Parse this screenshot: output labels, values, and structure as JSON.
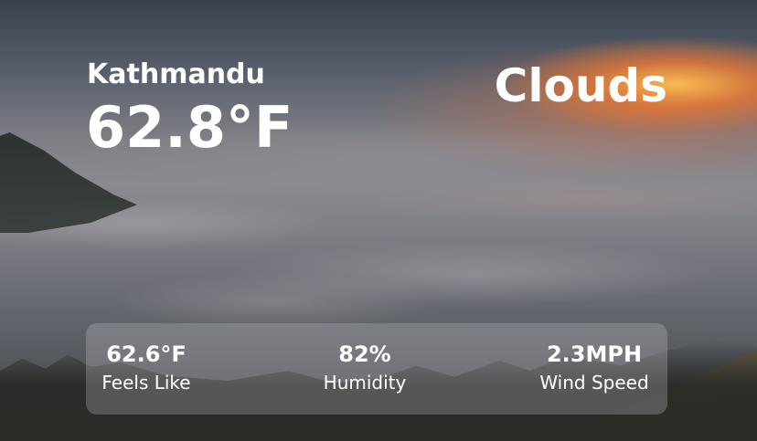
{
  "weather": {
    "city": "Kathmandu",
    "temperature": "62.8°F",
    "condition": "Clouds"
  },
  "details": {
    "feels_like": {
      "value": "62.6°F",
      "label": "Feels Like"
    },
    "humidity": {
      "value": "82%",
      "label": "Humidity"
    },
    "wind_speed": {
      "value": "2.3MPH",
      "label": "Wind Speed"
    }
  }
}
